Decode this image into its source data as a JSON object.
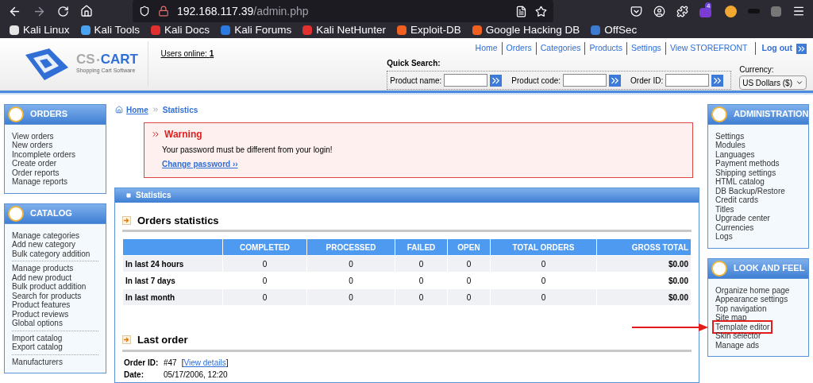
{
  "browser": {
    "url_host": "192.168.117.39",
    "url_path": "/admin.php",
    "extension_badge": "4",
    "bookmarks": [
      "Kali Linux",
      "Kali Tools",
      "Kali Docs",
      "Kali Forums",
      "Kali NetHunter",
      "Exploit-DB",
      "Google Hacking DB",
      "OffSec"
    ]
  },
  "header": {
    "logo": {
      "part1": "CS",
      "part2": "CART",
      "tagline": "Shopping Cart Software"
    },
    "users_online_label": "Users online:",
    "users_online_count": "1",
    "nav": [
      "Home",
      "Orders",
      "Categories",
      "Products",
      "Settings",
      "View STOREFRONT"
    ],
    "logout": "Log out",
    "quick_search": {
      "title": "Quick Search:",
      "fields": [
        "Product name:",
        "Product code:",
        "Order ID:"
      ]
    },
    "currency": {
      "label": "Currency:",
      "value": "US Dollars ($)"
    }
  },
  "left_sidebar": [
    {
      "title": "ORDERS",
      "groups": [
        [
          "View orders",
          "New orders",
          "Incomplete orders",
          "Create order",
          "Order reports",
          "Manage reports"
        ]
      ]
    },
    {
      "title": "CATALOG",
      "groups": [
        [
          "Manage categories",
          "Add new category",
          "Bulk category addition"
        ],
        [
          "Manage products",
          "Add new product",
          "Bulk product addition",
          "Search for products",
          "Product features",
          "Product reviews",
          "Global options"
        ],
        [
          "Import catalog",
          "Export catalog"
        ],
        [
          "Manufacturers"
        ]
      ]
    }
  ],
  "breadcrumb": [
    "Home",
    "Statistics"
  ],
  "warning": {
    "title": "Warning",
    "message": "Your password must be different from your login!",
    "link": "Change password ››"
  },
  "panel_title": "Statistics",
  "orders_statistics": {
    "title": "Orders statistics",
    "columns": [
      "",
      "COMPLETED",
      "PROCESSED",
      "FAILED",
      "OPEN",
      "TOTAL ORDERS",
      "GROSS TOTAL"
    ],
    "rows": [
      [
        "In last 24 hours",
        "0",
        "0",
        "0",
        "0",
        "0",
        "$0.00"
      ],
      [
        "In last 7 days",
        "0",
        "0",
        "0",
        "0",
        "0",
        "$0.00"
      ],
      [
        "In last month",
        "0",
        "0",
        "0",
        "0",
        "0",
        "$0.00"
      ]
    ]
  },
  "last_order": {
    "title": "Last order",
    "fields": [
      {
        "label": "Order ID:",
        "value": "#47",
        "link": "View details",
        "link_prefix": "[",
        "link_suffix": "]"
      },
      {
        "label": "Date:",
        "value": "05/17/2006, 12:20"
      }
    ]
  },
  "right_sidebar": [
    {
      "title": "ADMINISTRATION",
      "items": [
        {
          "label": "Settings",
          "highlighted": false
        },
        {
          "label": "Modules",
          "highlighted": false
        },
        {
          "label": "Languages",
          "highlighted": false
        },
        {
          "label": "Payment methods",
          "highlighted": false
        },
        {
          "label": "Shipping settings",
          "highlighted": false
        },
        {
          "label": "HTML catalog",
          "highlighted": false
        },
        {
          "label": "DB Backup/Restore",
          "highlighted": false
        },
        {
          "label": "Credit cards",
          "highlighted": false
        },
        {
          "label": "Titles",
          "highlighted": false
        },
        {
          "label": "Upgrade center",
          "highlighted": false
        },
        {
          "label": "Currencies",
          "highlighted": false
        },
        {
          "label": "Logs",
          "highlighted": false
        }
      ]
    },
    {
      "title": "LOOK AND FEEL",
      "items": [
        {
          "label": "Organize home page",
          "highlighted": false
        },
        {
          "label": "Appearance settings",
          "highlighted": false
        },
        {
          "label": "Top navigation",
          "highlighted": false
        },
        {
          "label": "Site map",
          "highlighted": false
        },
        {
          "label": "Template editor",
          "highlighted": true
        },
        {
          "label": "Skin selector",
          "highlighted": false
        },
        {
          "label": "Manage ads",
          "highlighted": false
        }
      ]
    }
  ]
}
